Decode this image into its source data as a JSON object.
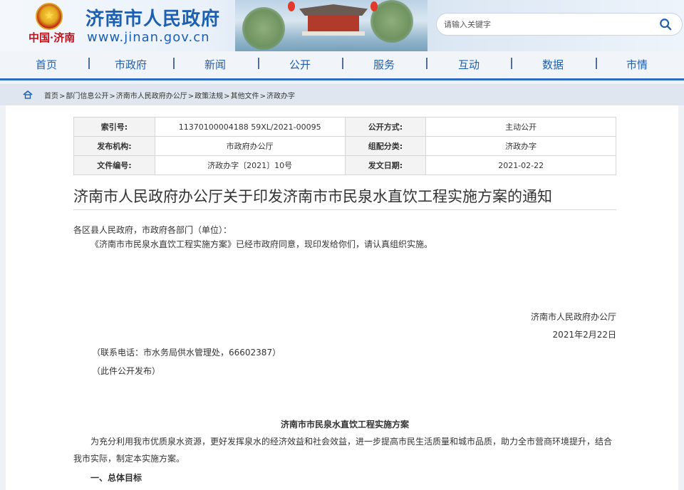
{
  "header": {
    "site_title": "济南市人民政府",
    "site_url": "www.jinan.gov.cn",
    "emblem_text": "中国·济南",
    "search_placeholder": "请输入关键字",
    "brand_color": "#1d5fb0"
  },
  "nav": {
    "items": [
      "首页",
      "市政府",
      "新闻",
      "公开",
      "服务",
      "互动",
      "数据",
      "市情"
    ]
  },
  "breadcrumb": [
    "首页",
    "部门信息公开",
    "济南市人民政府办公厅",
    "政策法规",
    "其他文件",
    "济政办字"
  ],
  "meta": {
    "index_label": "索引号:",
    "index_value": "11370100004188 59XL/2021-00095",
    "public_label": "公开方式:",
    "public_value": "主动公开",
    "issuer_label": "发布机构:",
    "issuer_value": "市政府办公厅",
    "category_label": "组配分类:",
    "category_value": "济政办字",
    "docno_label": "文件编号:",
    "docno_value": "济政办字〔2021〕10号",
    "date_label": "发文日期:",
    "date_value": "2021-02-22"
  },
  "doc": {
    "title": "济南市人民政府办公厅关于印发济南市市民泉水直饮工程实施方案的通知",
    "salutation": "各区县人民政府，市政府各部门（单位）：",
    "body1": "《济南市市民泉水直饮工程实施方案》已经市政府同意，现印发给你们，请认真组织实施。",
    "signer": "济南市人民政府办公厅",
    "sign_date": "2021年2月22日",
    "contact": "（联系电话：市水务局供水管理处，66602387）",
    "publish_note": "（此件公开发布）",
    "sub_title": "济南市市民泉水直饮工程实施方案",
    "intro": "为充分利用我市优质泉水资源，更好发挥泉水的经济效益和社会效益，进一步提高市民生活质量和城市品质，助力全市营商环境提升，结合我市实际，制定本实施方案。",
    "section1": "一、总体目标"
  }
}
